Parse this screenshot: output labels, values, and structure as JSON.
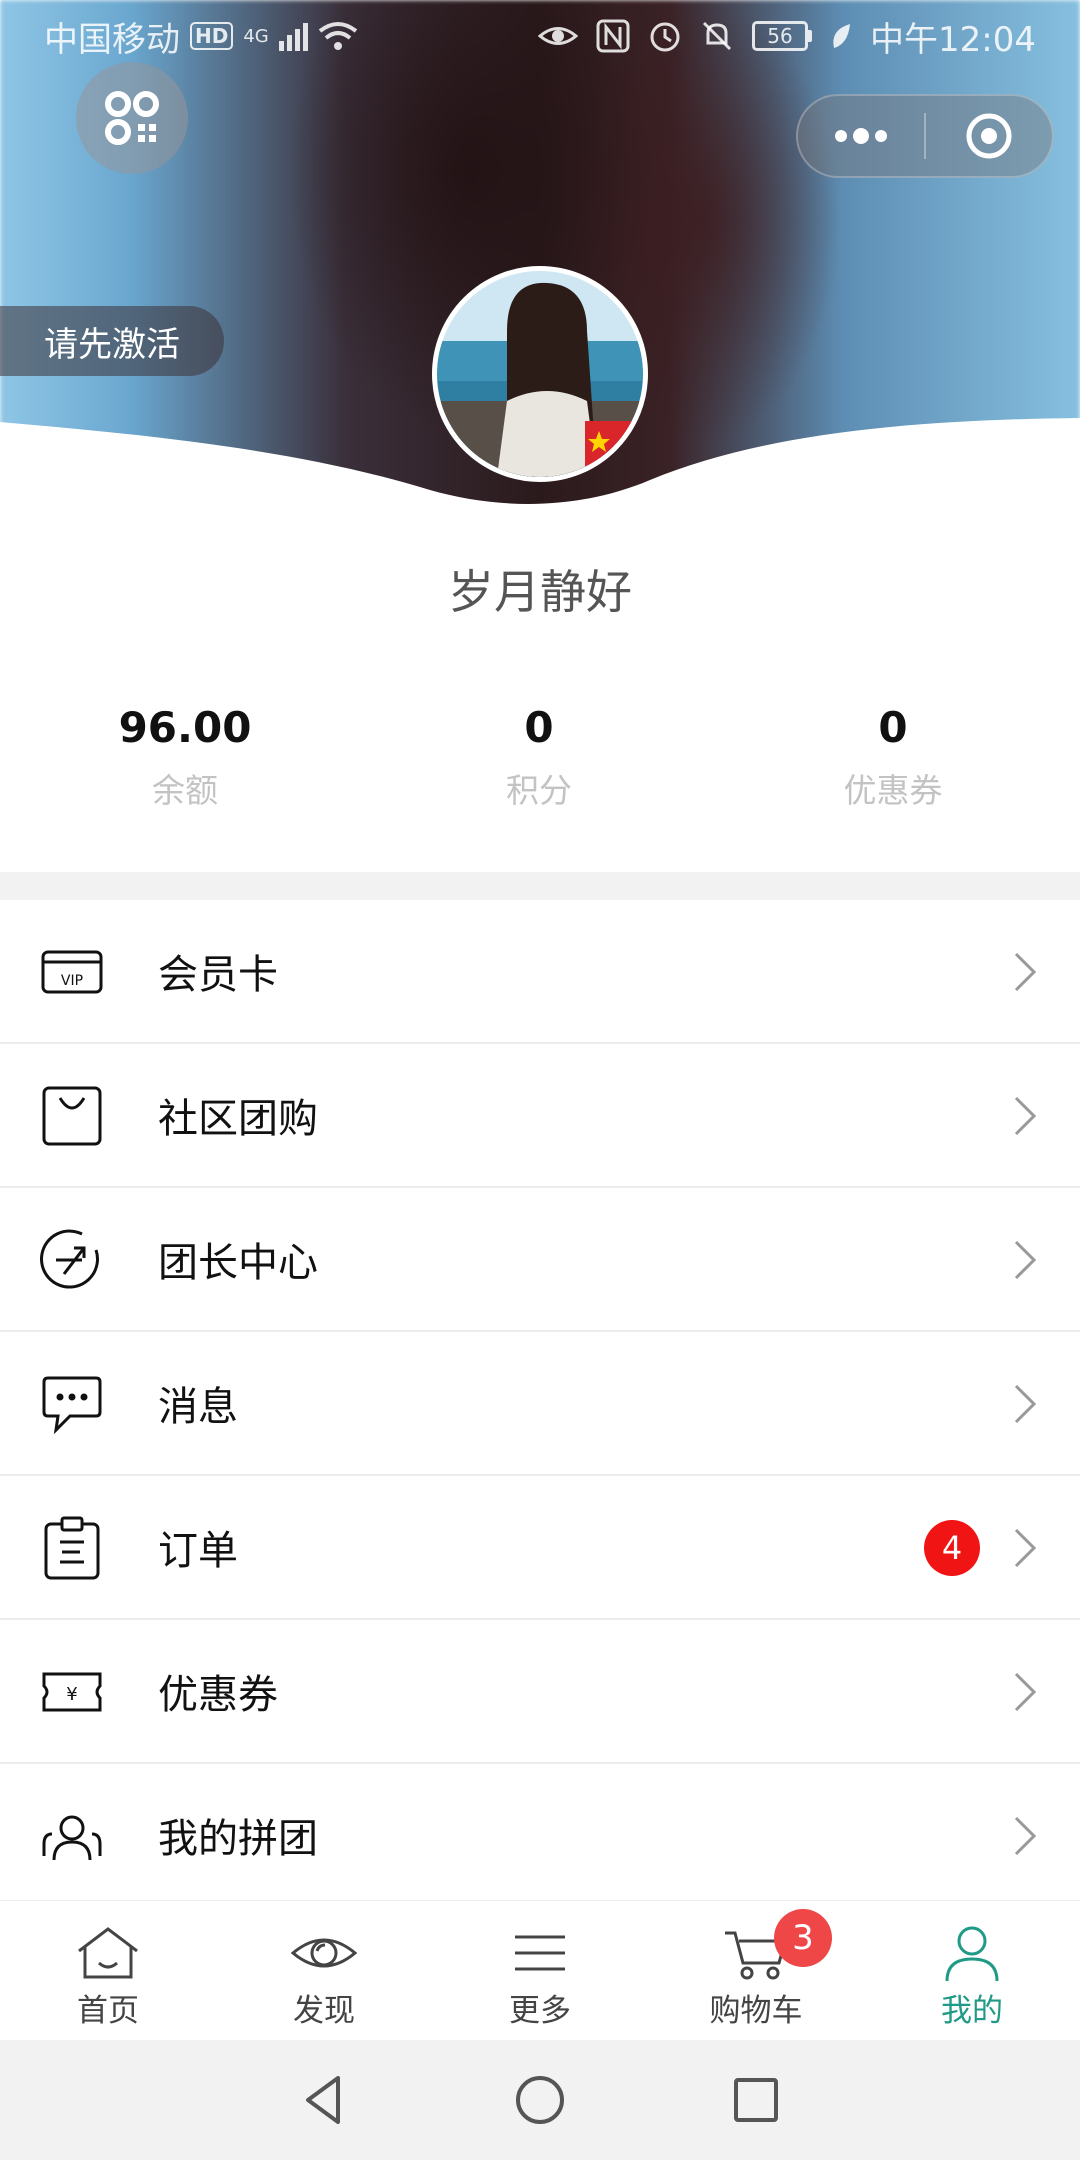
{
  "status_bar": {
    "carrier": "中国移动",
    "hd_label": "HD",
    "network": "4G",
    "battery": "56",
    "time": "中午12:04"
  },
  "header": {
    "activate_label": "请先激活",
    "username": "岁月静好"
  },
  "stats": [
    {
      "value": "96.00",
      "label": "余额"
    },
    {
      "value": "0",
      "label": "积分"
    },
    {
      "value": "0",
      "label": "优惠券"
    }
  ],
  "menu": [
    {
      "label": "会员卡",
      "icon": "vip-card-icon"
    },
    {
      "label": "社区团购",
      "icon": "shopping-bag-icon"
    },
    {
      "label": "团长中心",
      "icon": "leader-center-icon"
    },
    {
      "label": "消息",
      "icon": "chat-bubble-icon"
    },
    {
      "label": "订单",
      "icon": "clipboard-icon",
      "badge": "4"
    },
    {
      "label": "优惠券",
      "icon": "coupon-ticket-icon"
    },
    {
      "label": "我的拼团",
      "icon": "group-buy-icon"
    }
  ],
  "tabbar": {
    "items": [
      {
        "label": "首页",
        "icon": "home-icon"
      },
      {
        "label": "发现",
        "icon": "eye-icon"
      },
      {
        "label": "更多",
        "icon": "menu-lines-icon"
      },
      {
        "label": "购物车",
        "icon": "cart-icon",
        "badge": "3"
      },
      {
        "label": "我的",
        "icon": "user-icon",
        "active": true
      }
    ]
  },
  "colors": {
    "accent": "#1f9a86",
    "badge_red": "#f01414",
    "cart_badge": "#ef4648",
    "section_gap": "#f2f2f2"
  }
}
